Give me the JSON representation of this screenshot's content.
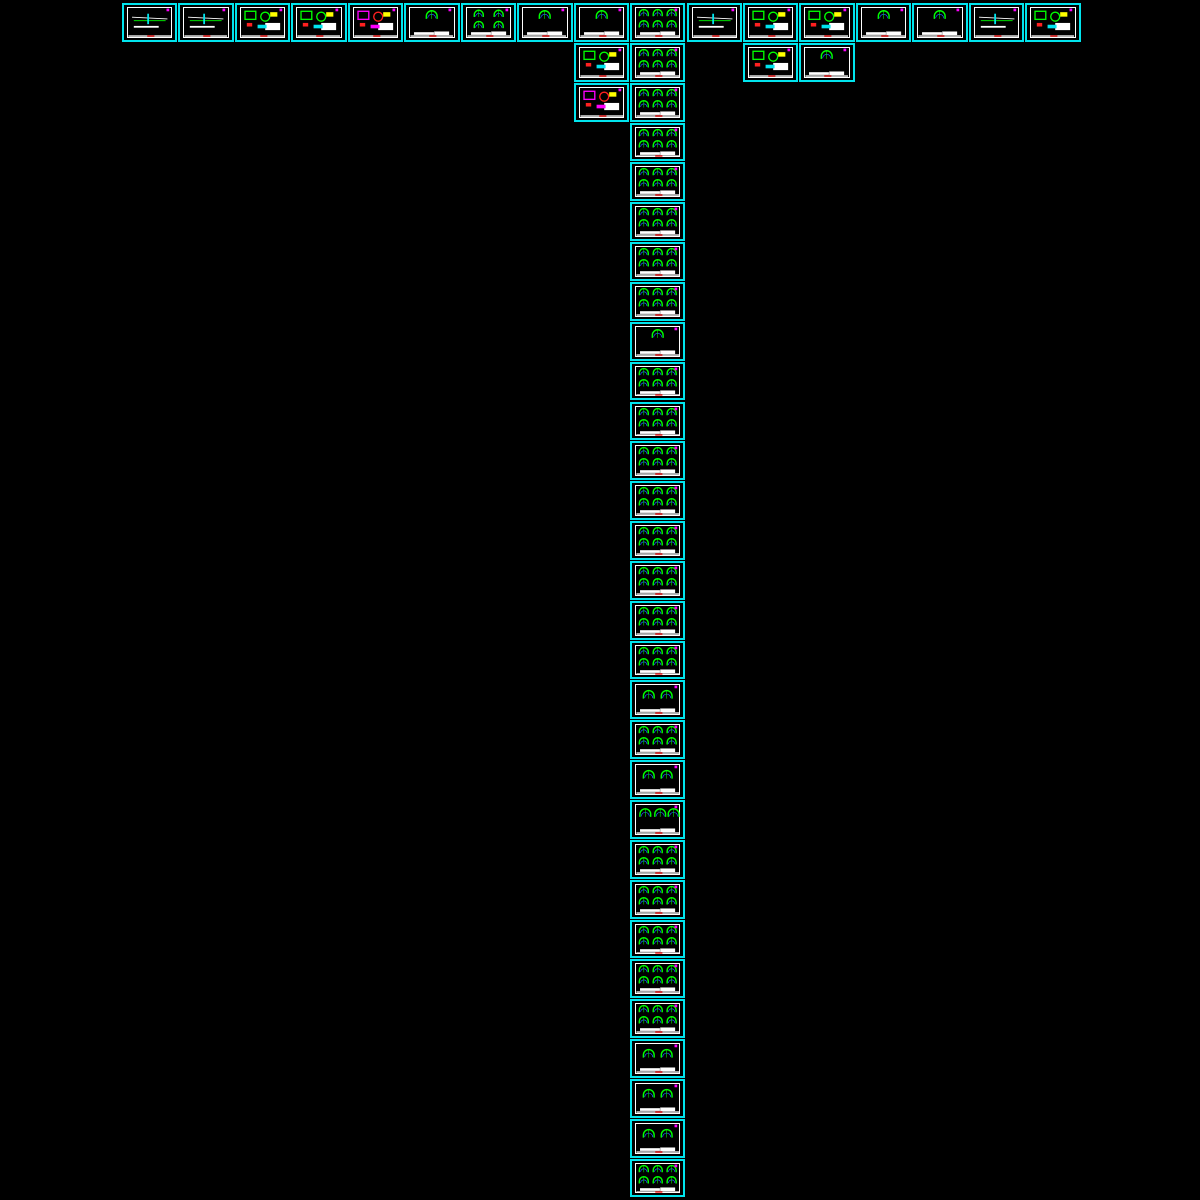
{
  "colors": {
    "background": "#000000",
    "frame": "#00e5ee",
    "border": "#ffffff",
    "arch": "#00ff00",
    "lining": "#2060ff",
    "accent": "#ff00ff",
    "red": "#ff2020",
    "yellow": "#ffff00"
  },
  "top_row": [
    "plan",
    "plan",
    "detail",
    "detail",
    "detail-magenta",
    "sections1",
    "sections4",
    "sections1",
    "sections1",
    "sections6",
    "plan",
    "detail",
    "detail",
    "sections1",
    "sections1",
    "plan",
    "detail"
  ],
  "extra_sheets": [
    {
      "col": 8,
      "row": 1,
      "kind": "detail"
    },
    {
      "col": 8,
      "row": 2,
      "kind": "detail-magenta"
    },
    {
      "col": 11,
      "row": 1,
      "kind": "detail"
    },
    {
      "col": 12,
      "row": 1,
      "kind": "sections1"
    }
  ],
  "column_sheets": [
    "sections6",
    "sections6",
    "sections6",
    "sections6",
    "sections6",
    "sections6",
    "sections6",
    "sections6",
    "sections1",
    "sections6",
    "sections6",
    "sections6",
    "sections6",
    "sections6",
    "sections6",
    "sections6",
    "sections6",
    "sections2",
    "sections6",
    "sections2",
    "sections3",
    "sections6",
    "sections6",
    "sections6",
    "sections6",
    "sections6",
    "sections2",
    "sections2",
    "sections2",
    "sections6"
  ]
}
